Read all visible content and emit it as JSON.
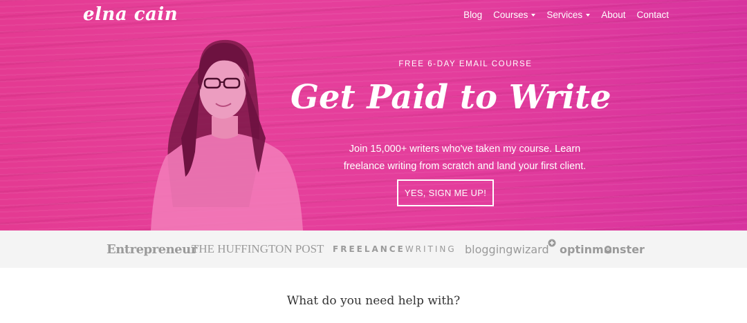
{
  "colors": {
    "hero_pink": "#e43d97",
    "press_bar": "#f4f4f4",
    "press_text": "#9a9a9a",
    "heading": "#333333"
  },
  "header": {
    "logo": "elna cain",
    "nav": [
      {
        "label": "Blog",
        "has_dropdown": false
      },
      {
        "label": "Courses",
        "has_dropdown": true
      },
      {
        "label": "Services",
        "has_dropdown": true
      },
      {
        "label": "About",
        "has_dropdown": false
      },
      {
        "label": "Contact",
        "has_dropdown": false
      }
    ]
  },
  "hero": {
    "eyebrow": "FREE 6-DAY EMAIL COURSE",
    "headline": "Get Paid to Write",
    "subtext_line1": "Join 15,000+ writers who've taken my course. Learn",
    "subtext_line2": "freelance writing from scratch and land your first client.",
    "cta": "YES, SIGN ME UP!"
  },
  "press": {
    "logos": [
      "Entrepreneur",
      "THE HUFFINGTON POST",
      "FREELANCEWRITING",
      "bloggingwizard",
      "optinmonster"
    ],
    "freelance_a": "FREELANCE",
    "freelance_b": "WRITING",
    "optin_a": "optinm",
    "optin_b": "nster"
  },
  "main": {
    "section_title": "What do you need help with?"
  }
}
